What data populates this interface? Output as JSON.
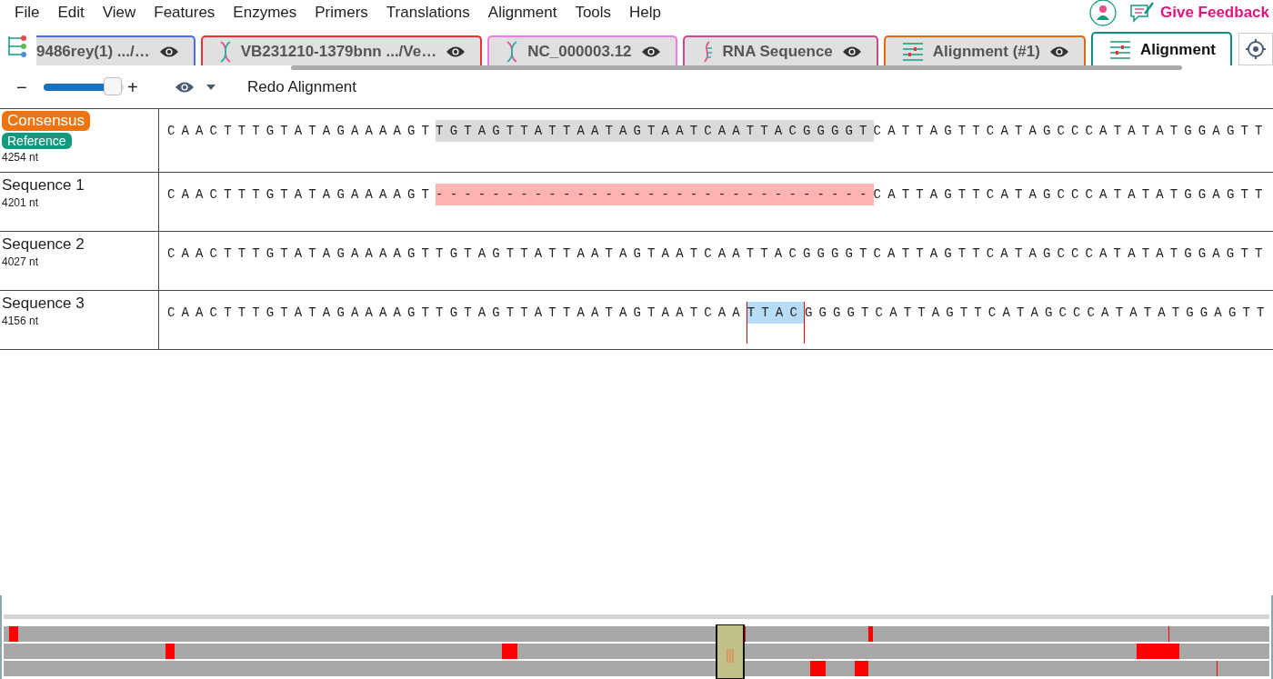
{
  "menu": [
    "File",
    "Edit",
    "View",
    "Features",
    "Enzymes",
    "Primers",
    "Translations",
    "Alignment",
    "Tools",
    "Help"
  ],
  "feedback": {
    "label": "Give Feedback"
  },
  "tabs": [
    {
      "label": "9486rey(1) .../…",
      "kind": "plain",
      "color": "#4a6cf7",
      "selected": false,
      "eye": true
    },
    {
      "label": "VB231210-1379bnn .../Ve…",
      "kind": "dna",
      "color": "#ee3030",
      "selected": false,
      "eye": true
    },
    {
      "label": "NC_000003.12",
      "kind": "dna",
      "color": "#f07ce8",
      "selected": false,
      "eye": true
    },
    {
      "label": "RNA Sequence",
      "kind": "rna",
      "color": "#d04a8a",
      "selected": false,
      "eye": true
    },
    {
      "label": "Alignment (#1)",
      "kind": "alignment",
      "color": "#e0680f",
      "selected": false,
      "eye": true
    },
    {
      "label": "Alignment",
      "kind": "alignment",
      "color": "#0b8f80",
      "selected": true,
      "eye": false
    }
  ],
  "toolbar": {
    "zoom_minus": "−",
    "zoom_plus": "+",
    "zoom": {
      "level": 0.86
    },
    "redo": "Redo Alignment"
  },
  "rows": [
    {
      "kind": "consensus",
      "badges": [
        {
          "label": "Consensus",
          "color": "#ef7410"
        },
        {
          "label": "Reference",
          "color": "#129a7e"
        }
      ],
      "length": "4254 nt",
      "segments": [
        {
          "text": "CAACTTTGTATAGAAAAGT",
          "kind": "plain"
        },
        {
          "text": "TGTAGTTATTAATAGTAATCAATTACGGGGT",
          "kind": "match"
        },
        {
          "text": "CATTAGTTCATAGCCCATATATGGAGTT",
          "kind": "plain"
        }
      ]
    },
    {
      "kind": "sequence",
      "name": "Sequence 1",
      "length": "4201 nt",
      "segments": [
        {
          "text": "CAACTTTGTATAGAAAAGT",
          "kind": "plain"
        },
        {
          "text": "-------------------------------",
          "kind": "gap"
        },
        {
          "text": "CATTAGTTCATAGCCCATATATGGAGTT",
          "kind": "plain"
        }
      ]
    },
    {
      "kind": "sequence",
      "name": "Sequence 2",
      "length": "4027 nt",
      "segments": [
        {
          "text": "CAACTTTGTATAGAAAAGTTGTAGTTATTAATAGTAATCAATTACGGGGTCATTAGTTCATAGCCCATATATGGAGTT",
          "kind": "plain"
        }
      ]
    },
    {
      "kind": "sequence",
      "name": "Sequence 3",
      "length": "4156 nt",
      "segments": [
        {
          "text": "CAACTTTGTATAGAAAAGTTGTAGTTATTAATAGTAATCAA",
          "kind": "plain"
        },
        {
          "text": "TTAC",
          "kind": "selected"
        },
        {
          "text": "GGGGTCATTAGTTCATAGCCCATATATGGAGTT",
          "kind": "plain"
        }
      ]
    }
  ]
}
